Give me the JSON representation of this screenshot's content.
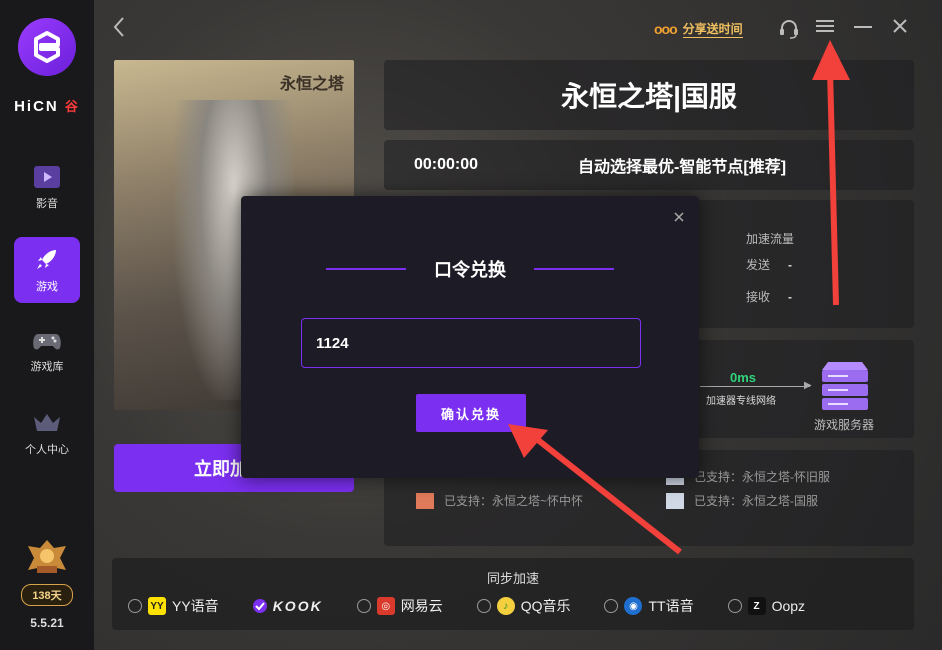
{
  "sidebar": {
    "brand": "HiCN",
    "brand_tag": "谷",
    "items": [
      {
        "label": "影音"
      },
      {
        "label": "游戏"
      },
      {
        "label": "游戏库"
      },
      {
        "label": "个人中心"
      }
    ],
    "days_badge": "138天",
    "version": "5.5.21"
  },
  "topbar": {
    "share_label": "分享送时间"
  },
  "game": {
    "poster_title": "永恒之塔",
    "title": "永恒之塔|国服",
    "start_button": "立即加",
    "timer": "00:00:00",
    "node": "自动选择最优-智能节点[推荐]"
  },
  "stats": {
    "header": "加速流量",
    "send_label": "发送",
    "send_value": "-",
    "recv_label": "接收",
    "recv_value": "-"
  },
  "network": {
    "latency": "0ms",
    "route_label": "加速器专线网络",
    "server_label": "游戏服务器"
  },
  "support": {
    "items": [
      "已支持：永恒之塔-怀旧服",
      "已支持：永恒之塔~怀中怀",
      "已支持：永恒之塔-国服"
    ]
  },
  "sync": {
    "header": "同步加速",
    "options": [
      {
        "label": "YY语音",
        "checked": false
      },
      {
        "label": "KOOK",
        "checked": true
      },
      {
        "label": "网易云",
        "checked": false
      },
      {
        "label": "QQ音乐",
        "checked": false
      },
      {
        "label": "TT语音",
        "checked": false
      },
      {
        "label": "Oopz",
        "checked": false
      }
    ]
  },
  "modal": {
    "title": "口令兑换",
    "input_value": "1124",
    "confirm_label": "确认兑换"
  },
  "colors": {
    "accent": "#7b2ff0",
    "latency": "#30d27a",
    "share": "#f0c060"
  }
}
